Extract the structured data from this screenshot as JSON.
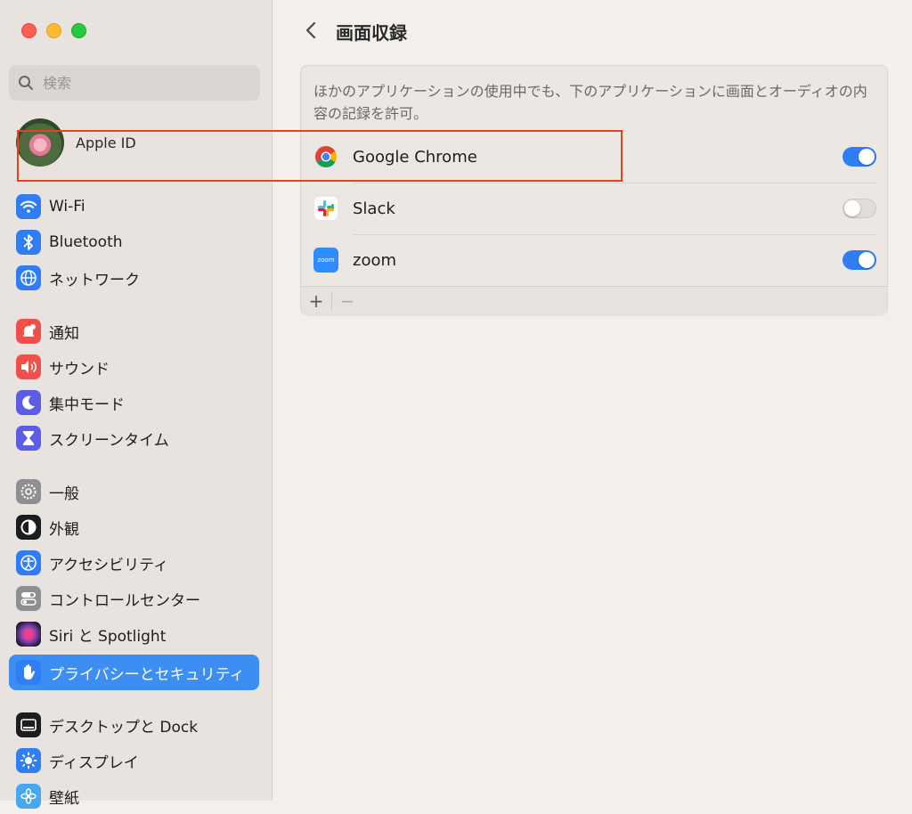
{
  "sidebar": {
    "search_placeholder": "検索",
    "apple_id_label": "Apple ID",
    "items": [
      {
        "label": "Wi-Fi",
        "icon": "wifi-icon",
        "color": "#2f7ef6"
      },
      {
        "label": "Bluetooth",
        "icon": "bluetooth-icon",
        "color": "#2f7ef6"
      },
      {
        "label": "ネットワーク",
        "icon": "globe-icon",
        "color": "#2f7ef6"
      },
      {
        "label": "通知",
        "icon": "bell-icon",
        "color": "#f0504a"
      },
      {
        "label": "サウンド",
        "icon": "speaker-icon",
        "color": "#f0504a"
      },
      {
        "label": "集中モード",
        "icon": "moon-icon",
        "color": "#5d5ce6"
      },
      {
        "label": "スクリーンタイム",
        "icon": "hourglass-icon",
        "color": "#5d5ce6"
      },
      {
        "label": "一般",
        "icon": "gear-icon",
        "color": "#8e8e93"
      },
      {
        "label": "外観",
        "icon": "appearance-icon",
        "color": "#1d1d1f"
      },
      {
        "label": "アクセシビリティ",
        "icon": "accessibility-icon",
        "color": "#2f7ef6"
      },
      {
        "label": "コントロールセンター",
        "icon": "control-center-icon",
        "color": "#8e8e93"
      },
      {
        "label": "Siri と Spotlight",
        "icon": "siri-icon",
        "color": "#7a3fb0"
      },
      {
        "label": "プライバシーとセキュリティ",
        "icon": "hand-icon",
        "color": "#2f7ef6",
        "selected": true
      },
      {
        "label": "デスクトップと Dock",
        "icon": "dock-icon",
        "color": "#1d1d1f"
      },
      {
        "label": "ディスプレイ",
        "icon": "sun-icon",
        "color": "#2f7ef6"
      },
      {
        "label": "壁紙",
        "icon": "wallpaper-icon",
        "color": "#45a8f0"
      }
    ]
  },
  "main": {
    "title": "画面収録",
    "description": "ほかのアプリケーションの使用中でも、下のアプリケーションに画面とオーディオの内容の記録を許可。",
    "apps": [
      {
        "name": "Google Chrome",
        "icon": "chrome-icon",
        "enabled": true
      },
      {
        "name": "Slack",
        "icon": "slack-icon",
        "enabled": false
      },
      {
        "name": "zoom",
        "icon": "zoom-icon",
        "icon_text": "zoom",
        "enabled": true
      }
    ],
    "add_label": "+",
    "remove_label": "−",
    "highlight_color": "#e8411e"
  }
}
